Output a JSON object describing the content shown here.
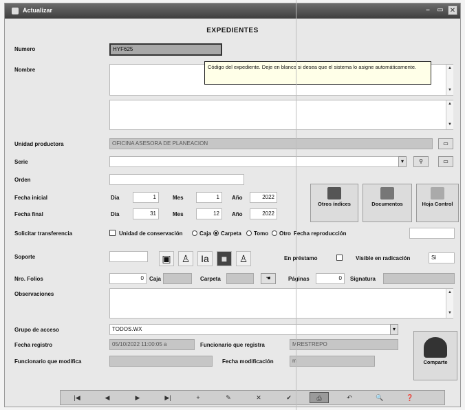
{
  "window": {
    "title": "Actualizar",
    "heading": "EXPEDIENTES"
  },
  "labels": {
    "numero": "Numero",
    "nombre": "Nombre",
    "unidad": "Unidad productora",
    "serie": "Serie",
    "orden": "Orden",
    "fecha_inicial": "Fecha inicial",
    "fecha_final": "Fecha final",
    "solicitar": "Solicitar transferencia",
    "soporte": "Soporte",
    "nro_folios": "Nro. Folios",
    "observaciones": "Observaciones",
    "grupo": "Grupo de acceso",
    "fecha_registro": "Fecha registro",
    "funcionario_modifica": "Funcionario que modifica",
    "dia": "Dia",
    "mes": "Mes",
    "anio": "Año",
    "unidad_conservacion": "Unidad de conservación",
    "caja": "Caja",
    "carpeta": "Carpeta",
    "tomo": "Tomo",
    "otro": "Otro",
    "fecha_reproduccion": "Fecha reproducción",
    "en_prestamo": "En préstamo",
    "visible_radicacion": "Visible en radicación",
    "caja2": "Caja",
    "carpeta2": "Carpeta",
    "paginas": "Páginas",
    "signatura": "Signatura",
    "funcionario_registra": "Funcionario que registra",
    "fecha_modificacion": "Fecha modificación"
  },
  "values": {
    "numero": "HYF625",
    "unidad": "OFICINA ASESORA DE PLANEACION",
    "fecha_inicial": {
      "dia": "1",
      "mes": "1",
      "anio": "2022"
    },
    "fecha_final": {
      "dia": "31",
      "mes": "12",
      "anio": "2022"
    },
    "folios": "0",
    "paginas": "0",
    "visible_si": "Si",
    "grupo": "TODOS.WX",
    "fecha_registro": "05/10/2022 11:00:05 a",
    "funcionario_registra": "MRESTREPO",
    "fecha_modificacion": "m"
  },
  "tooltip": "Código del expediente. Deje en blanco si desea que el sistema lo asigne automáticamente.",
  "buttons": {
    "otros_indices": "Otros índices",
    "documentos": "Documentos",
    "hoja_control": "Hoja Control",
    "comparte": "Comparte"
  },
  "navigation": [
    "|◀",
    "◀",
    "▶",
    "▶|",
    "+",
    "✎",
    "✕",
    "✔",
    "⎙",
    "↶",
    "🔍",
    "❓"
  ]
}
